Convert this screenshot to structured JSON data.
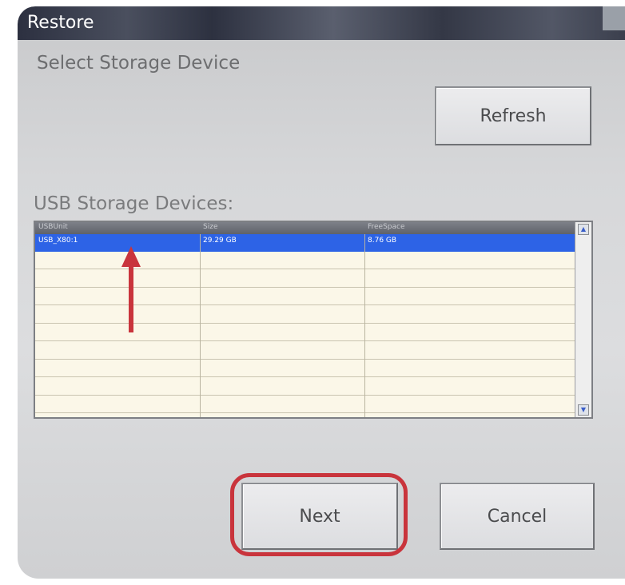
{
  "window": {
    "title": "Restore"
  },
  "headings": {
    "select_device": "Select Storage Device",
    "usb_devices": "USB Storage Devices:"
  },
  "buttons": {
    "refresh": "Refresh",
    "next": "Next",
    "cancel": "Cancel"
  },
  "table": {
    "columns": [
      "USBUnit",
      "Size",
      "FreeSpace"
    ],
    "rows": [
      {
        "unit": "USB_X80:1",
        "size": "29.29 GB",
        "free": "8.76 GB",
        "selected": true
      }
    ],
    "empty_rows": 9
  },
  "scrollbar": {
    "up_icon": "scroll-up-arrow-icon",
    "down_icon": "scroll-down-arrow-icon"
  },
  "colors": {
    "selection": "#2d63e6",
    "annotation": "#c9343c",
    "table_bg": "#fbf7e8"
  }
}
